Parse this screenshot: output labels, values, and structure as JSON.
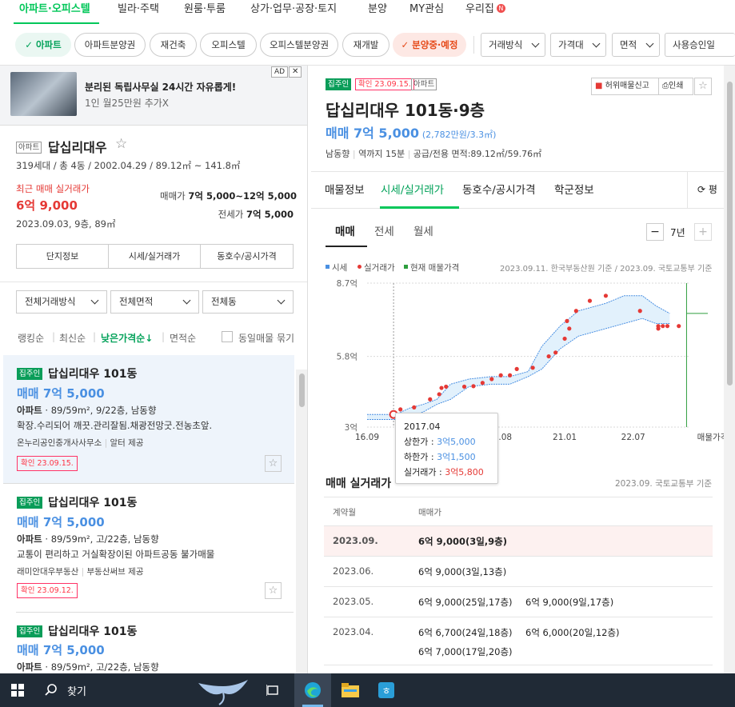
{
  "nav": {
    "items": [
      {
        "label": "아파트·오피스텔",
        "active": true
      },
      {
        "label": "빌라·주택"
      },
      {
        "label": "원룸·투룸"
      },
      {
        "label": "상가·업무·공장·토지"
      },
      {
        "label": "분양"
      },
      {
        "label": "MY관심"
      },
      {
        "label": "우리집"
      }
    ],
    "new_badge": "N"
  },
  "filters": {
    "chips": [
      "아파트",
      "아파트분양권",
      "재건축",
      "오피스텔",
      "오피스텔분양권",
      "재개발",
      "분양중·예정"
    ],
    "dropdowns": [
      "거래방식",
      "가격대",
      "면적",
      "사용승인일"
    ]
  },
  "ad": {
    "badge": "AD",
    "close": "✕",
    "title": "분리된 독립사무실 24시간 자유롭게!",
    "subtitle": "1인 월25만원 추가X"
  },
  "complex": {
    "type_tag": "아파트",
    "name": "답십리대우",
    "info": "319세대 / 총 4동 / 2002.04.29 / 89.12㎡ ~ 141.8㎡",
    "recent_label": "최근 매매 실거래가",
    "recent_price": "6억 9,000",
    "recent_date": "2023.09.03, 9층, 89㎡",
    "sale_label": "매매가",
    "sale_range": "7억 5,000~12억 5,000",
    "jeonse_label": "전세가",
    "jeonse_price": "7억 5,000",
    "buttons": [
      "단지정보",
      "시세/실거래가",
      "동호수/공시가격"
    ],
    "selects": [
      "전체거래방식",
      "전체면적",
      "전체동"
    ],
    "sorts": [
      "랭킹순",
      "최신순",
      "낮은가격순↓",
      "면적순"
    ],
    "same_listing": "동일매물 묶기"
  },
  "listings": [
    {
      "tag": "집주인",
      "title": "답십리대우 101동",
      "price": "매매 7억 5,000",
      "spec_type": "아파트",
      "spec": " · 89/59m², 9/22층, 남동향",
      "desc": "확장.수리되어 깨끗.관리잘됨.채광전망굿.전농초앞.",
      "agent": "온누리공인중개사사무소",
      "provider": "알터 제공",
      "confirm": "확인 23.09.15."
    },
    {
      "tag": "집주인",
      "title": "답십리대우 101동",
      "price": "매매 7억 5,000",
      "spec_type": "아파트",
      "spec": " · 89/59m², 고/22층, 남동향",
      "desc": "교통이 편리하고 거실확장이된 아파트공동 불가매물",
      "agent": "래미안대우부동산",
      "provider": "부동산써브 제공",
      "confirm": "확인 23.09.12."
    },
    {
      "tag": "집주인",
      "title": "답십리대우 101동",
      "price": "매매 7억 5,000",
      "spec_type": "아파트",
      "spec": " · 89/59m², 고/22층, 남동향"
    }
  ],
  "detail": {
    "tag_owner": "집주인",
    "tag_confirm": "확인 23.09.15.",
    "tag_type": "아파트",
    "report": "허위매물신고",
    "print": "인쇄",
    "title": "답십리대우 101동·9층",
    "price": "매매 7억 5,000",
    "unit_price": "(2,782만원/3.3㎡)",
    "facing": "남동향",
    "station": "역까지 15분",
    "area": "공급/전용 면적:89.12㎡/59.76㎡",
    "tabs": [
      "매물정보",
      "시세/실거래가",
      "동호수/공시가격",
      "학군정보"
    ],
    "tab_extra": "평",
    "subtabs": [
      "매매",
      "전세",
      "월세"
    ],
    "period": "7년",
    "period_minus": "−",
    "period_plus": "+",
    "legend": [
      "시세",
      "실거래가",
      "현재 매물가격"
    ],
    "source": "2023.09.11. 한국부동산원 기준 / 2023.09. 국토교통부 기준",
    "tooltip": {
      "date": "2017.04",
      "upper_label": "상한가 : ",
      "upper": "3억5,000",
      "lower_label": "하한가 : ",
      "lower": "3억1,500",
      "real_label": "실거래가 : ",
      "real": "3억5,800"
    },
    "tx_title": "매매 실거래가",
    "tx_source": "2023.09. 국토교통부 기준",
    "tx_headers": [
      "계약월",
      "매매가"
    ],
    "tx_rows": [
      {
        "month": "2023.09.",
        "v1": "6억 9,000(3일,9층)",
        "v2": ""
      },
      {
        "month": "2023.06.",
        "v1": "6억 9,000(3일,13층)",
        "v2": ""
      },
      {
        "month": "2023.05.",
        "v1": "6억 9,000(25일,17층)",
        "v2": "6억 9,000(9일,17층)"
      },
      {
        "month": "2023.04.",
        "v1": "6억 6,700(24일,18층)",
        "v2": "6억 6,000(20일,12층)",
        "v3": "6억 7,000(17일,20층)"
      }
    ]
  },
  "chart_data": {
    "type": "line",
    "y_tick_labels": [
      "3억",
      "5.8억",
      "8.7억"
    ],
    "y_ticks": [
      3.0,
      5.8,
      8.7
    ],
    "ylim": [
      3.0,
      8.7
    ],
    "x_tick_labels": [
      "16.09",
      "18.03",
      "19.08",
      "21.01",
      "22.07"
    ],
    "x_end_label": "매물가격",
    "x_ticks": [
      2016.67,
      2018.17,
      2019.58,
      2021.0,
      2022.5
    ],
    "xlim": [
      2016.67,
      2023.75
    ],
    "series": [
      {
        "name": "시세",
        "upper": [
          [
            2016.67,
            3.5
          ],
          [
            2017.3,
            3.5
          ],
          [
            2017.6,
            3.75
          ],
          [
            2017.9,
            3.9
          ],
          [
            2018.2,
            4.1
          ],
          [
            2018.5,
            4.7
          ],
          [
            2018.9,
            4.9
          ],
          [
            2019.4,
            5.0
          ],
          [
            2019.8,
            5.0
          ],
          [
            2020.2,
            5.2
          ],
          [
            2020.5,
            6.2
          ],
          [
            2020.9,
            7.0
          ],
          [
            2021.3,
            7.6
          ],
          [
            2021.9,
            7.9
          ],
          [
            2022.3,
            8.2
          ],
          [
            2022.7,
            8.2
          ],
          [
            2023.0,
            7.8
          ],
          [
            2023.3,
            7.5
          ]
        ],
        "lower": [
          [
            2016.67,
            3.3
          ],
          [
            2017.3,
            3.3
          ],
          [
            2017.6,
            3.4
          ],
          [
            2017.9,
            3.6
          ],
          [
            2018.2,
            3.9
          ],
          [
            2018.5,
            4.1
          ],
          [
            2018.9,
            4.6
          ],
          [
            2019.4,
            4.7
          ],
          [
            2019.8,
            4.7
          ],
          [
            2020.2,
            5.0
          ],
          [
            2020.5,
            5.3
          ],
          [
            2020.9,
            6.1
          ],
          [
            2021.3,
            6.6
          ],
          [
            2021.9,
            6.9
          ],
          [
            2022.3,
            7.1
          ],
          [
            2022.7,
            7.3
          ],
          [
            2023.0,
            7.1
          ],
          [
            2023.3,
            7.1
          ]
        ]
      },
      {
        "name": "실거래가",
        "points": [
          [
            2017.25,
            3.58
          ],
          [
            2017.4,
            3.7
          ],
          [
            2017.7,
            3.78
          ],
          [
            2018.05,
            4.1
          ],
          [
            2018.25,
            4.3
          ],
          [
            2018.3,
            4.55
          ],
          [
            2018.4,
            4.6
          ],
          [
            2018.8,
            4.6
          ],
          [
            2019.0,
            4.62
          ],
          [
            2019.2,
            4.75
          ],
          [
            2019.4,
            4.9
          ],
          [
            2019.6,
            5.05
          ],
          [
            2019.8,
            5.05
          ],
          [
            2019.95,
            5.3
          ],
          [
            2020.3,
            5.35
          ],
          [
            2020.65,
            5.8
          ],
          [
            2020.8,
            5.95
          ],
          [
            2021.0,
            6.5
          ],
          [
            2021.05,
            7.2
          ],
          [
            2021.1,
            6.9
          ],
          [
            2021.25,
            7.6
          ],
          [
            2021.55,
            8.0
          ],
          [
            2021.9,
            8.2
          ],
          [
            2022.65,
            7.6
          ],
          [
            2023.05,
            7.0
          ],
          [
            2023.05,
            6.9
          ],
          [
            2023.15,
            7.0
          ],
          [
            2023.25,
            7.0
          ],
          [
            2023.5,
            7.0
          ]
        ]
      },
      {
        "name": "현재 매물가격",
        "points": [
          [
            2023.67,
            7.5
          ]
        ]
      }
    ],
    "tooltip_x": 2017.25
  },
  "taskbar": {
    "search": "찾기"
  },
  "colors": {
    "accent": "#03c75a",
    "price_blue": "#4a90e2",
    "red": "#e53935",
    "band": "#dbeefb"
  }
}
